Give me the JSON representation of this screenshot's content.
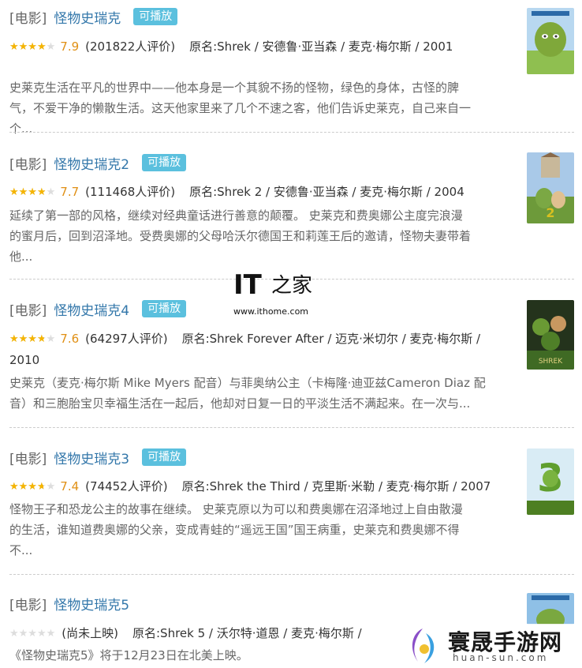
{
  "items": [
    {
      "category": "[电影]",
      "title": "怪物史瑞克",
      "badge": "可播放",
      "stars_fraction": 0.79,
      "score": "7.9",
      "votes": "(201822人评价)",
      "original": "原名:Shrek / 安德鲁·亚当森 / 麦克·梅尔斯 / 2001",
      "desc_lines": [
        "史莱克生活在平凡的世界中——他本身是一个其貌不扬的怪物，绿色的身体，古怪的脾",
        "气，不爱干净的懒散生活。这天他家里来了几个不速之客，他们告诉史莱克，自己来自一",
        "个..."
      ],
      "poster_color": "#7fa83a",
      "poster_bg": "#b8d8f0"
    },
    {
      "category": "[电影]",
      "title": "怪物史瑞克2",
      "badge": "可播放",
      "stars_fraction": 0.77,
      "score": "7.7",
      "votes": "(111468人评价)",
      "original": "原名:Shrek 2 / 安德鲁·亚当森 / 麦克·梅尔斯 / 2004",
      "desc_lines": [
        "延续了第一部的风格，继续对经典童话进行善意的颠覆。 史莱克和费奥娜公主度完浪漫",
        "的蜜月后，回到沼泽地。受费奥娜的父母哈沃尔德国王和莉莲王后的邀请，怪物夫妻带着",
        "他..."
      ],
      "poster_color": "#6d9a3a",
      "poster_bg": "#a9c9e8"
    },
    {
      "category": "[电影]",
      "title": "怪物史瑞克4",
      "badge": "可播放",
      "stars_fraction": 0.76,
      "score": "7.6",
      "votes": "(64297人评价)",
      "original": "原名:Shrek Forever After / 迈克·米切尔 / 麦克·梅尔斯 /",
      "original2": "2010",
      "desc_lines": [
        "史莱克（麦克·梅尔斯 Mike Myers 配音）与菲奥纳公主（卡梅隆·迪亚兹Cameron Diaz 配",
        "音）和三胞胎宝贝幸福生活在一起后，他却对日复一日的平淡生活不满起来。在一次与..."
      ],
      "poster_color": "#3f6a24",
      "poster_bg": "#24331c"
    },
    {
      "category": "[电影]",
      "title": "怪物史瑞克3",
      "badge": "可播放",
      "stars_fraction": 0.74,
      "score": "7.4",
      "votes": "(74452人评价)",
      "original": "原名:Shrek the Third / 克里斯·米勒 / 麦克·梅尔斯 / 2007",
      "desc_lines": [
        "怪物王子和恐龙公主的故事在继续。 史莱克原以为可以和费奥娜在沼泽地过上自由散漫",
        "的生活，谁知道费奥娜的父亲，变成青蛙的“遥远王国”国王病重，史莱克和费奥娜不得",
        "不..."
      ],
      "poster_color": "#5f9e2e",
      "poster_bg": "#d9ecf5"
    },
    {
      "category": "[电影]",
      "title": "怪物史瑞克5",
      "stars_fraction": 0,
      "votes": "(尚未上映)",
      "original": "原名:Shrek 5 / 沃尔特·道恩 / 麦克·梅尔斯 /",
      "desc_lines": [
        "《怪物史瑞克5》将于12月23日在北美上映。"
      ],
      "poster_color": "#7aa840",
      "poster_bg": "#8fc0e6"
    }
  ],
  "watermark_it": {
    "logo": "IT之家",
    "url": "www.ithome.com"
  },
  "watermark_site": {
    "name": "寰晟手游网",
    "url": "huan-sun.com"
  },
  "colors": {
    "link": "#3377aa",
    "badge": "#5bc0de",
    "star": "#f5b400",
    "score": "#e09015"
  }
}
